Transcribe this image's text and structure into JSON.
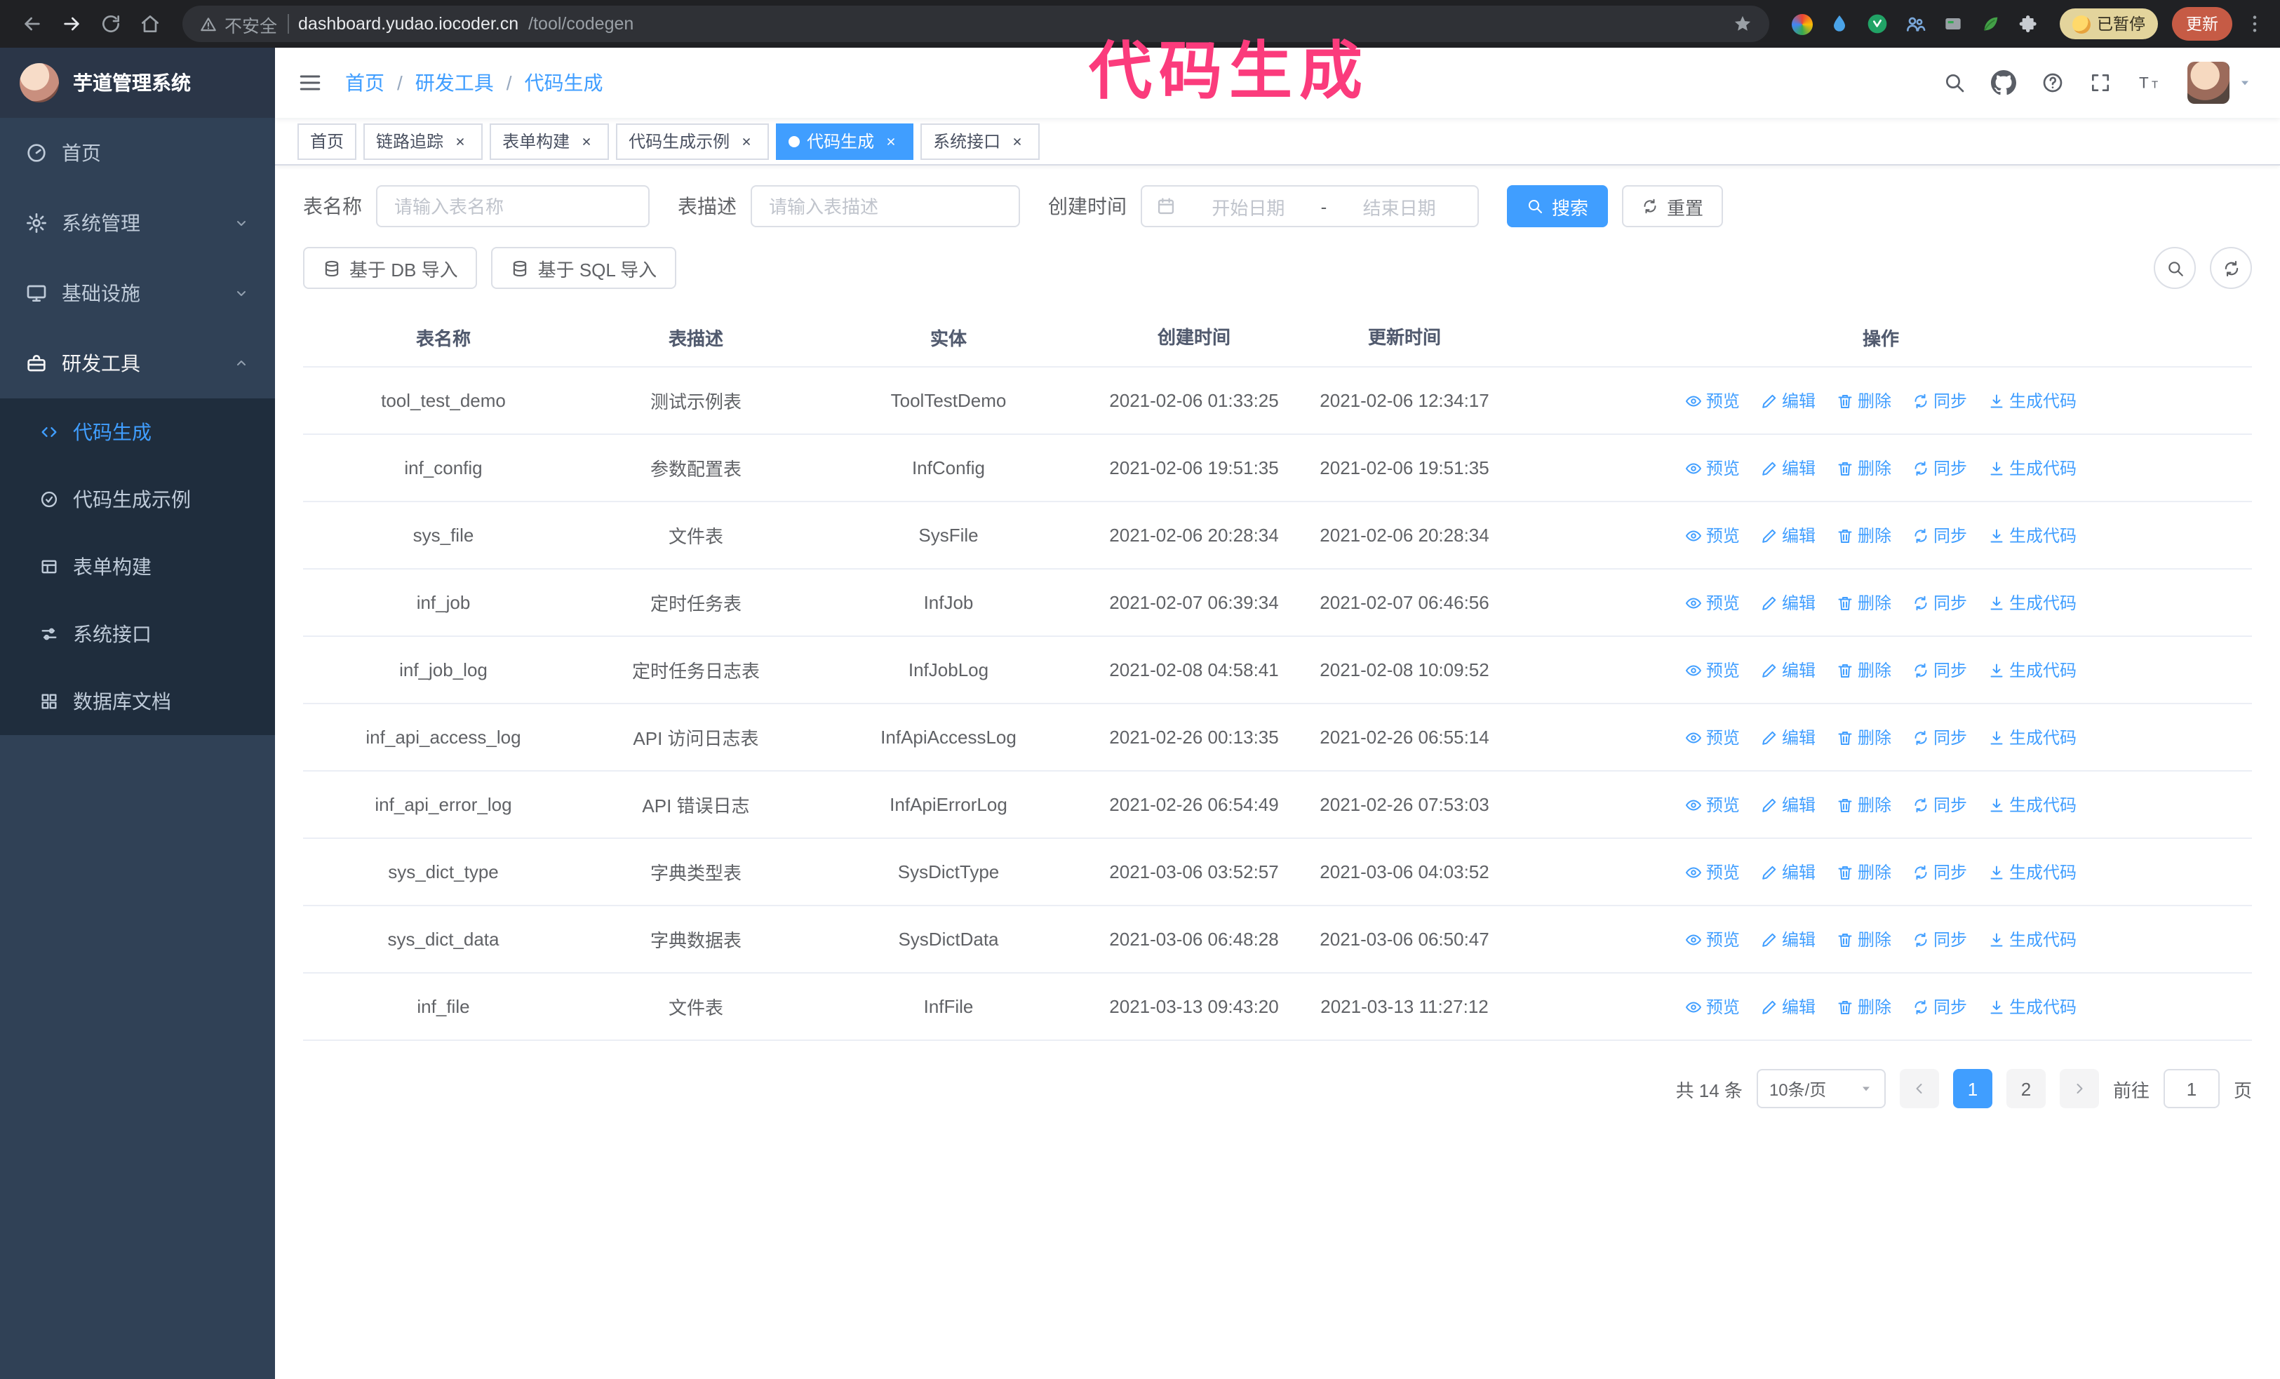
{
  "colors": {
    "accent": "#409eff",
    "sidebar_bg": "#304156",
    "submenu_bg": "#1f2d3d",
    "annotation": "#fb3b7c",
    "chrome_bar": "#202124",
    "update_button_bg": "#c65b45"
  },
  "annotation": {
    "text": "代码生成"
  },
  "browser": {
    "security_label": "不安全",
    "url_host": "dashboard.yudao.iocoder.cn",
    "url_path": "/tool/codegen",
    "profile_chip": "已暂停",
    "update_button": "更新",
    "nav_icons": [
      "back-icon",
      "forward-icon",
      "reload-icon",
      "home-icon"
    ],
    "extension_icons": [
      "colorful-extension-icon",
      "drop-icon",
      "green-badge-icon",
      "people-icon",
      "card-icon",
      "leaf-icon",
      "puzzle-icon"
    ]
  },
  "sidebar": {
    "logo_title": "芋道管理系统",
    "items": [
      {
        "label": "首页",
        "icon": "dashboard-icon"
      },
      {
        "label": "系统管理",
        "icon": "gear-icon"
      },
      {
        "label": "基础设施",
        "icon": "monitor-icon"
      },
      {
        "label": "研发工具",
        "icon": "toolbox-icon"
      }
    ],
    "submenu": [
      {
        "label": "代码生成",
        "icon": "code-icon",
        "active": true
      },
      {
        "label": "代码生成示例",
        "icon": "example-icon"
      },
      {
        "label": "表单构建",
        "icon": "form-icon"
      },
      {
        "label": "系统接口",
        "icon": "api-icon"
      },
      {
        "label": "数据库文档",
        "icon": "database-doc-icon"
      }
    ]
  },
  "header": {
    "breadcrumb": [
      "首页",
      "研发工具",
      "代码生成"
    ],
    "right_icons": [
      "search-icon",
      "github-icon",
      "help-icon",
      "fullscreen-icon",
      "font-size-icon",
      "avatar",
      "caret-down-icon"
    ]
  },
  "tabs": [
    {
      "label": "首页",
      "closable": false,
      "active": false
    },
    {
      "label": "链路追踪",
      "closable": true,
      "active": false
    },
    {
      "label": "表单构建",
      "closable": true,
      "active": false
    },
    {
      "label": "代码生成示例",
      "closable": true,
      "active": false
    },
    {
      "label": "代码生成",
      "closable": true,
      "active": true
    },
    {
      "label": "系统接口",
      "closable": true,
      "active": false
    }
  ],
  "filters": {
    "name_label": "表名称",
    "name_placeholder": "请输入表名称",
    "desc_label": "表描述",
    "desc_placeholder": "请输入表描述",
    "date_label": "创建时间",
    "date_start_placeholder": "开始日期",
    "date_separator": "-",
    "date_end_placeholder": "结束日期",
    "search_button": "搜索",
    "reset_button": "重置"
  },
  "toolbar": {
    "import_db": "基于 DB 导入",
    "import_sql": "基于 SQL 导入",
    "right_icons": [
      "search-toggle-icon",
      "refresh-icon"
    ]
  },
  "table": {
    "columns": [
      "表名称",
      "表描述",
      "实体",
      "创建时间",
      "更新时间",
      "操作"
    ],
    "actions": [
      {
        "label": "预览",
        "icon": "eye"
      },
      {
        "label": "编辑",
        "icon": "edit"
      },
      {
        "label": "删除",
        "icon": "trash"
      },
      {
        "label": "同步",
        "icon": "sync"
      },
      {
        "label": "生成代码",
        "icon": "download"
      }
    ],
    "rows": [
      {
        "name": "tool_test_demo",
        "desc": "测试示例表",
        "entity": "ToolTestDemo",
        "created": "2021-02-06 01:33:25",
        "updated": "2021-02-06 12:34:17"
      },
      {
        "name": "inf_config",
        "desc": "参数配置表",
        "entity": "InfConfig",
        "created": "2021-02-06 19:51:35",
        "updated": "2021-02-06 19:51:35"
      },
      {
        "name": "sys_file",
        "desc": "文件表",
        "entity": "SysFile",
        "created": "2021-02-06 20:28:34",
        "updated": "2021-02-06 20:28:34"
      },
      {
        "name": "inf_job",
        "desc": "定时任务表",
        "entity": "InfJob",
        "created": "2021-02-07 06:39:34",
        "updated": "2021-02-07 06:46:56"
      },
      {
        "name": "inf_job_log",
        "desc": "定时任务日志表",
        "entity": "InfJobLog",
        "created": "2021-02-08 04:58:41",
        "updated": "2021-02-08 10:09:52"
      },
      {
        "name": "inf_api_access_log",
        "desc": "API 访问日志表",
        "entity": "InfApiAccessLog",
        "created": "2021-02-26 00:13:35",
        "updated": "2021-02-26 06:55:14"
      },
      {
        "name": "inf_api_error_log",
        "desc": "API 错误日志",
        "entity": "InfApiErrorLog",
        "created": "2021-02-26 06:54:49",
        "updated": "2021-02-26 07:53:03"
      },
      {
        "name": "sys_dict_type",
        "desc": "字典类型表",
        "entity": "SysDictType",
        "created": "2021-03-06 03:52:57",
        "updated": "2021-03-06 04:03:52"
      },
      {
        "name": "sys_dict_data",
        "desc": "字典数据表",
        "entity": "SysDictData",
        "created": "2021-03-06 06:48:28",
        "updated": "2021-03-06 06:50:47"
      },
      {
        "name": "inf_file",
        "desc": "文件表",
        "entity": "InfFile",
        "created": "2021-03-13 09:43:20",
        "updated": "2021-03-13 11:27:12"
      }
    ]
  },
  "pagination": {
    "total": "共 14 条",
    "page_size": "10条/页",
    "pages": [
      "1",
      "2"
    ],
    "active_page": "1",
    "goto_prefix": "前往",
    "goto_value": "1",
    "goto_suffix": "页"
  }
}
